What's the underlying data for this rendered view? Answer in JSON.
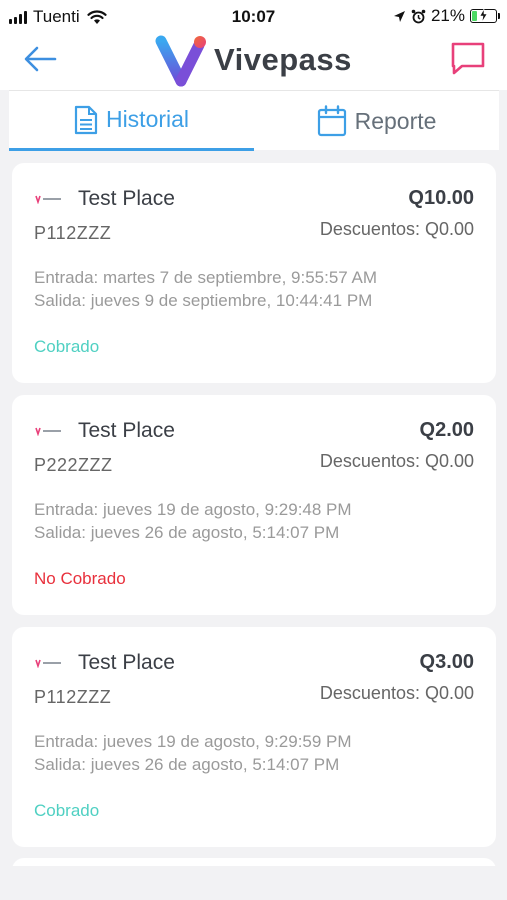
{
  "status_bar": {
    "carrier": "Tuenti",
    "time": "10:07",
    "battery_percent": "21%",
    "battery_level": 0.21
  },
  "header": {
    "brand": "Vivepass",
    "back_icon": "arrow-left-icon",
    "chat_icon": "chat-bubble-icon"
  },
  "tabs": [
    {
      "label": "Historial",
      "icon": "document-icon",
      "active": true
    },
    {
      "label": "Reporte",
      "icon": "calendar-icon",
      "active": false
    }
  ],
  "records": [
    {
      "place": "Test Place",
      "plate": "P112ZZZ",
      "amount": "Q10.00",
      "discount": "Descuentos: Q0.00",
      "entrada": "Entrada: martes 7 de septiembre, 9:55:57 AM",
      "salida": "Salida: jueves 9 de septiembre, 10:44:41 PM",
      "status": "Cobrado",
      "status_color": "#4fd0c2"
    },
    {
      "place": "Test Place",
      "plate": "P222ZZZ",
      "amount": "Q2.00",
      "discount": "Descuentos: Q0.00",
      "entrada": "Entrada: jueves 19 de agosto, 9:29:48 PM",
      "salida": "Salida: jueves 26 de agosto, 5:14:07 PM",
      "status": "No Cobrado",
      "status_color": "#e8303c"
    },
    {
      "place": "Test Place",
      "plate": "P112ZZZ",
      "amount": "Q3.00",
      "discount": "Descuentos: Q0.00",
      "entrada": "Entrada: jueves 19 de agosto, 9:29:59 PM",
      "salida": "Salida: jueves 26 de agosto, 5:14:07 PM",
      "status": "Cobrado",
      "status_color": "#4fd0c2"
    }
  ],
  "colors": {
    "accent_blue": "#3d9fe6",
    "chat_pink": "#e8407a",
    "paid": "#4fd0c2",
    "unpaid": "#e8303c"
  }
}
